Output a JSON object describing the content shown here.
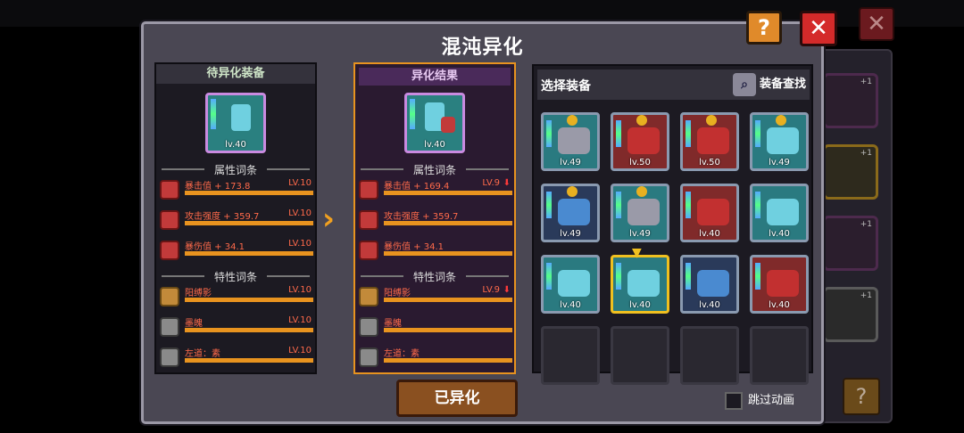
{
  "title": "混沌异化",
  "left_panel": {
    "header": "待异化装备",
    "item_level": "lv.40",
    "attr_header": "属性词条",
    "attrs": [
      {
        "name": "暴击值 + 173.8",
        "lv": "LV.10"
      },
      {
        "name": "攻击强度 + 359.7",
        "lv": "LV.10"
      },
      {
        "name": "暴伤值 + 34.1",
        "lv": "LV.10"
      }
    ],
    "trait_header": "特性词条",
    "traits": [
      {
        "name": "阳缚影",
        "lv": "LV.10"
      },
      {
        "name": "墨魄",
        "lv": "LV.10"
      },
      {
        "name": "左道：素",
        "lv": "LV.10"
      }
    ]
  },
  "right_panel": {
    "header": "异化结果",
    "item_level": "lv.40",
    "attr_header": "属性词条",
    "attrs": [
      {
        "name": "暴击值 + 169.4",
        "lv": "LV.9",
        "arrow": "⬇"
      },
      {
        "name": "攻击强度 + 359.7",
        "lv": ""
      },
      {
        "name": "暴伤值 + 34.1",
        "lv": ""
      }
    ],
    "trait_header": "特性词条",
    "traits": [
      {
        "name": "阳缚影",
        "lv": "LV.9",
        "arrow": "⬇"
      },
      {
        "name": "墨魄",
        "lv": ""
      },
      {
        "name": "左道：素",
        "lv": ""
      }
    ]
  },
  "select_panel": {
    "title": "选择装备",
    "search_label": "装备查找",
    "items": [
      {
        "lv": "lv.49"
      },
      {
        "lv": "lv.50"
      },
      {
        "lv": "lv.50"
      },
      {
        "lv": "lv.49"
      },
      {
        "lv": "lv.49"
      },
      {
        "lv": "lv.49"
      },
      {
        "lv": "lv.40"
      },
      {
        "lv": "lv.40"
      },
      {
        "lv": "lv.40"
      },
      {
        "lv": "lv.40"
      },
      {
        "lv": "lv.40"
      },
      {
        "lv": "lv.40"
      }
    ]
  },
  "done_button": "已异化",
  "skip_label": "跳过动画",
  "help_label": "?",
  "close_label": "✕",
  "bg_plus": "+1"
}
